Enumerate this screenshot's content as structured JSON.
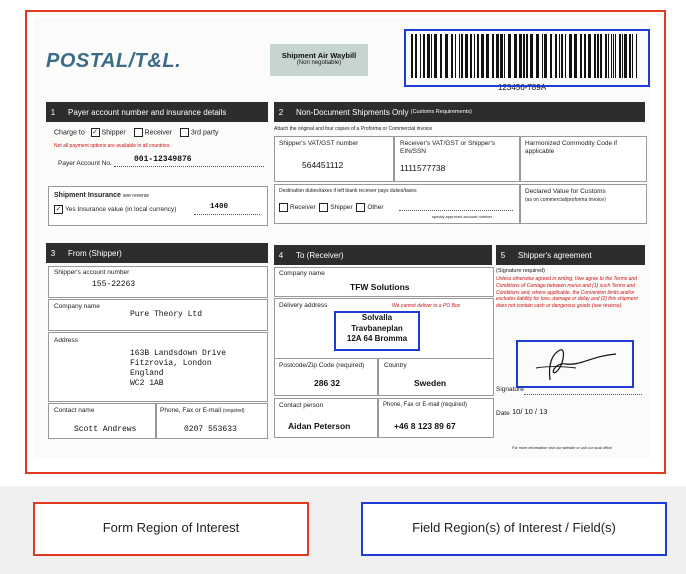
{
  "brand": {
    "logo": "POSTAL/T&L."
  },
  "title": {
    "main": "Shipment Air Waybill",
    "sub": "(Non negotiable)"
  },
  "barcode": {
    "number": "123456-789A"
  },
  "s1": {
    "num": "1",
    "title": "Payer account number and insurance details",
    "charge_to": "Charge to",
    "opt_shipper": "Shipper",
    "opt_receiver": "Receiver",
    "opt_third": "3rd party",
    "note": "Not all payment options are available in all countries.",
    "account_label": "Payer Account No.",
    "account_value": "001-12349876",
    "insurance_title": "Shipment Insurance",
    "insurance_see": "see reverse",
    "insurance_yes": "Yes Insurance value (in local currency)",
    "insurance_value": "1400"
  },
  "s2": {
    "num": "2",
    "title": "Non-Document Shipments Only",
    "title_note": "(Customs Requirements)",
    "attach": "Attach the original and four copies of a Proforma or Commercial invoice",
    "vat_label": "Shipper's VAT/GST number",
    "vat_value": "564451112",
    "rvat_label": "Receiver's VAT/GST or Shipper's EIN/SSN",
    "rvat_value": "1111577738",
    "hs_label": "Harmonized Commodity Code if applicable",
    "dest_label": "Destination duties/taxes if left blank receiver pays duties/taxes",
    "opt_receiver": "Receiver",
    "opt_shipper": "Shipper",
    "opt_other": "Other",
    "specify": "specify approved account number",
    "declared_label": "Declared Value for Customs",
    "declared_note": "(as on commercial/proforma invoice)"
  },
  "s3": {
    "num": "3",
    "title": "From (Shipper)",
    "account_label": "Shipper's account number",
    "account_value": "155-22263",
    "company_label": "Company name",
    "company_value": "Pure Theory Ltd",
    "address_label": "Address",
    "address_lines": [
      "163B Landsdown Drive",
      "Fitzrovia, London",
      "England",
      "WC2 1AB"
    ],
    "contact_label": "Contact name",
    "contact_value": "Scott Andrews",
    "phone_label": "Phone, Fax or E-mail",
    "phone_req": "(required)",
    "phone_value": "0207 553633"
  },
  "s4": {
    "num": "4",
    "title": "To (Receiver)",
    "company_label": "Company name",
    "company_value": "TFW Solutions",
    "delivery_label": "Delivery address",
    "delivery_note": "We cannot deliver to a PO Box",
    "delivery_lines": [
      "Solvalla",
      "Travbaneplan",
      "12A 64 Bromma"
    ],
    "postcode_label": "Postcode/Zip Code (required)",
    "postcode_value": "286 32",
    "country_label": "Country",
    "country_value": "Sweden",
    "contact_label": "Contact person",
    "contact_value": "Aidan Peterson",
    "phone_label": "Phone, Fax or E-mail (required)",
    "phone_value": "+46 8 123 89 67"
  },
  "s5": {
    "num": "5",
    "title": "Shipper's agreement",
    "sig_req": "(Signature required)",
    "terms": "Unless otherwise agreed in writing, I/we agree to the Terms and Conditions of Carriage between me/us and (1) such Terms and Conditions and, where applicable, the Convention limits and/or excludes liability for loss, damage or delay and (2) this shipment does not contain cash or dangerous goods (see reverse).",
    "signature_label": "Signature",
    "date_label": "Date",
    "date_value": "10/ 10 / 13",
    "footer": "For more information visit our website or call our local office"
  },
  "legend": {
    "form_roi": "Form Region of Interest",
    "field_roi": "Field Region(s) of Interest / Field(s)"
  },
  "colors": {
    "form_roi": "#e03a22",
    "field_roi": "#1f3bd6",
    "header_bar": "#2d2d2d"
  }
}
